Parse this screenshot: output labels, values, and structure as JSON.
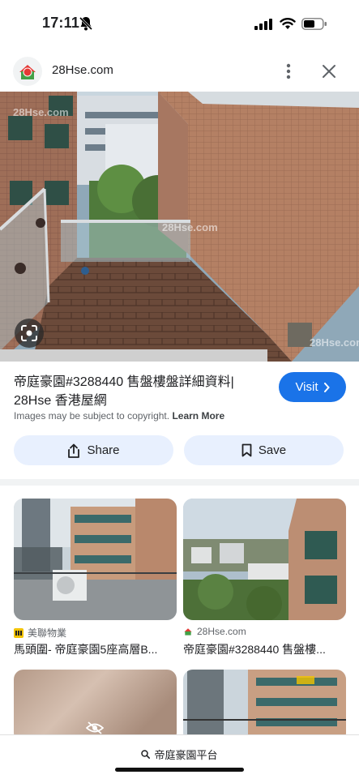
{
  "status": {
    "time": "17:11"
  },
  "header": {
    "site": "28Hse.com"
  },
  "result": {
    "title": "帝庭豪園#3288440 售盤樓盤詳細資料| 28Hse 香港屋網",
    "visit_label": "Visit",
    "copyright_text": "Images may be subject to copyright.",
    "learn_more": "Learn More",
    "share_label": "Share",
    "save_label": "Save",
    "watermark": "28Hse.com"
  },
  "related": [
    {
      "source": "美聯物業",
      "title": "馬頭圍- 帝庭豪園5座高層B..."
    },
    {
      "source": "28Hse.com",
      "title": "帝庭豪園#3288440 售盤樓..."
    }
  ],
  "bottom": {
    "query": "帝庭豪園平台"
  },
  "colors": {
    "accent": "#1a73e8",
    "button_bg": "#e8f0fe",
    "text": "#202124"
  }
}
